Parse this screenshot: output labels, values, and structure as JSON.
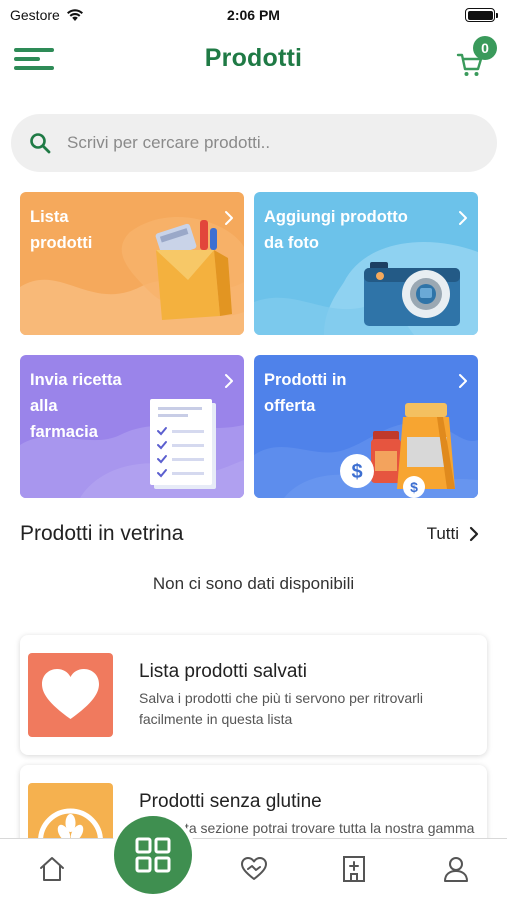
{
  "status_bar": {
    "carrier": "Gestore",
    "time": "2:06 PM"
  },
  "header": {
    "title": "Prodotti",
    "cart_count": "0"
  },
  "search": {
    "placeholder": "Scrivi per cercare prodotti.."
  },
  "tiles": [
    {
      "label": "Lista\nprodotti",
      "color": "#f5a95c"
    },
    {
      "label": "Aggiungi prodotto\nda foto",
      "color": "#6cc2ea"
    },
    {
      "label": "Invia ricetta\nalla\nfarmacia",
      "color": "#9a84ea"
    },
    {
      "label": "Prodotti in\nofferta",
      "color": "#4f82ea"
    }
  ],
  "featured": {
    "title": "Prodotti in vetrina",
    "see_all": "Tutti",
    "empty": "Non ci sono dati disponibili"
  },
  "cards": [
    {
      "title": "Lista prodotti salvati",
      "description": "Salva i prodotti che più ti servono per ritrovarli facilmente in questa lista",
      "icon_color": "#f07a5e",
      "icon": "heart-icon"
    },
    {
      "title": "Prodotti senza glutine",
      "description": "In questa sezione potrai trovare tutta la nostra gamma di prodotti senza glutine e prenotarli",
      "icon_color": "#f5b14f",
      "icon": "wheat-icon"
    }
  ],
  "tabbar": {
    "items": [
      "home-icon",
      "grid-icon",
      "heart-hand-icon",
      "pharmacy-icon",
      "profile-icon"
    ],
    "active": "grid-icon",
    "accent": "#3f8f50"
  }
}
